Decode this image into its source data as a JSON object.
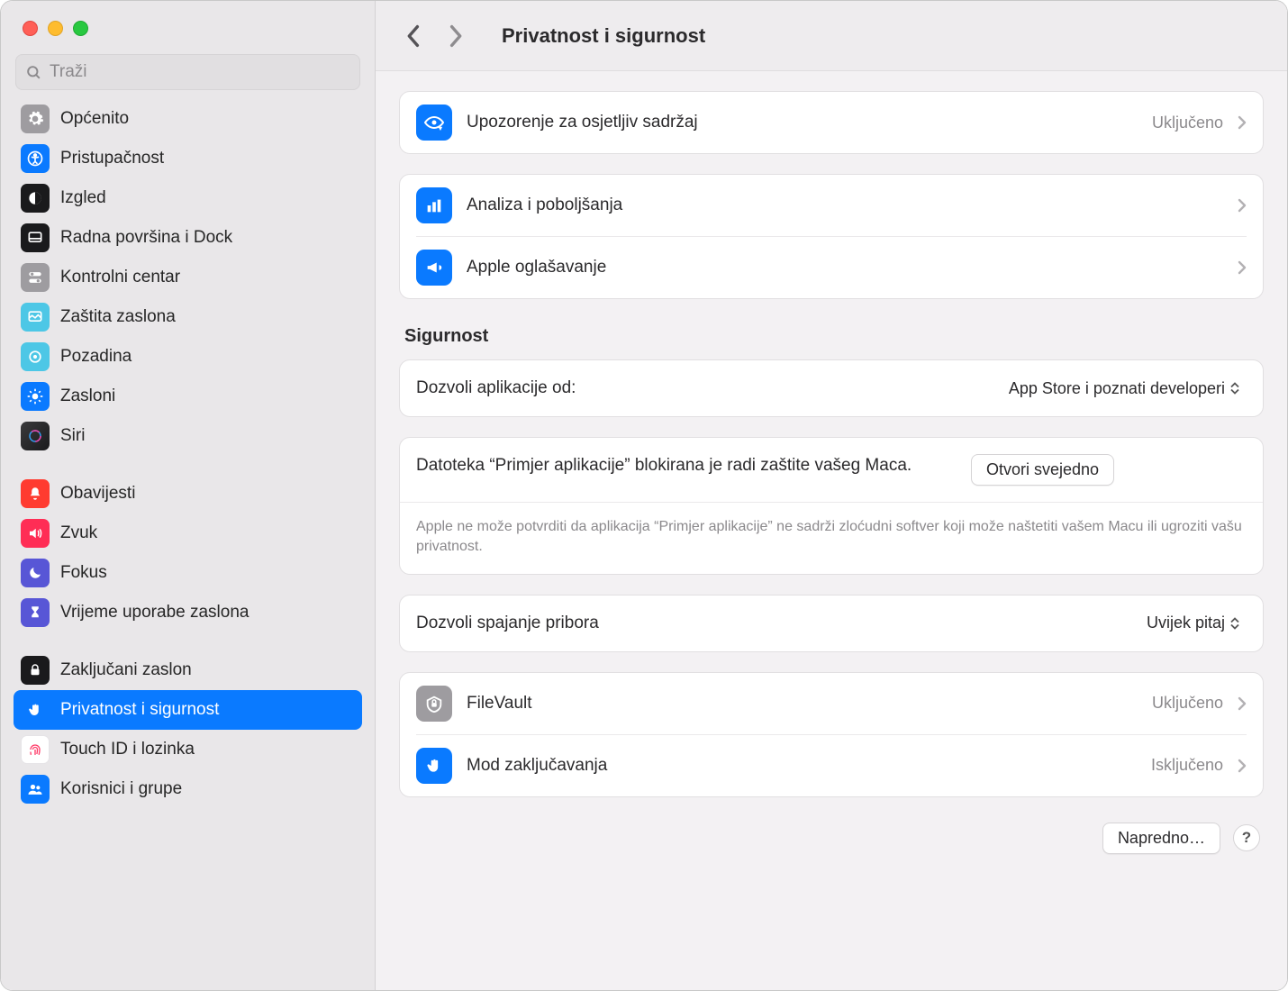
{
  "search_placeholder": "Traži",
  "page_title": "Privatnost i sigurnost",
  "sidebar": [
    {
      "label": "Općenito",
      "icon": "gear",
      "bg": "#9e9ca0"
    },
    {
      "label": "Pristupačnost",
      "icon": "accessibility",
      "bg": "#0a7aff"
    },
    {
      "label": "Izgled",
      "icon": "appearance",
      "bg": "#1a1a1c"
    },
    {
      "label": "Radna površina i Dock",
      "icon": "dock",
      "bg": "#1a1a1c"
    },
    {
      "label": "Kontrolni centar",
      "icon": "control",
      "bg": "#9e9ca0"
    },
    {
      "label": "Zaštita zaslona",
      "icon": "screensaver",
      "bg": "#4dc7e6"
    },
    {
      "label": "Pozadina",
      "icon": "wallpaper",
      "bg": "#4dc7e6"
    },
    {
      "label": "Zasloni",
      "icon": "displays",
      "bg": "#0a7aff"
    },
    {
      "label": "Siri",
      "icon": "siri",
      "bg": "#2b2a2c"
    }
  ],
  "sidebar2": [
    {
      "label": "Obavijesti",
      "icon": "bell",
      "bg": "#ff3b30"
    },
    {
      "label": "Zvuk",
      "icon": "sound",
      "bg": "#ff2d55"
    },
    {
      "label": "Fokus",
      "icon": "moon",
      "bg": "#5856d6"
    },
    {
      "label": "Vrijeme uporabe zaslona",
      "icon": "hourglass",
      "bg": "#5856d6"
    }
  ],
  "sidebar3": [
    {
      "label": "Zaključani zaslon",
      "icon": "lock",
      "bg": "#1a1a1c"
    },
    {
      "label": "Privatnost i sigurnost",
      "icon": "hand",
      "bg": "#0a7aff",
      "selected": true
    },
    {
      "label": "Touch ID i lozinka",
      "icon": "touchid",
      "bg": "#ffffff"
    },
    {
      "label": "Korisnici i grupe",
      "icon": "users",
      "bg": "#0a7aff"
    }
  ],
  "top_rows": {
    "sensitive": {
      "label": "Upozorenje za osjetljiv sadržaj",
      "status": "Uključeno"
    },
    "analytics": {
      "label": "Analiza i poboljšanja"
    },
    "advertising": {
      "label": "Apple oglašavanje"
    }
  },
  "security_header": "Sigurnost",
  "allow_apps": {
    "label": "Dozvoli aplikacije od:",
    "value": "App Store i poznati developeri"
  },
  "blocked": {
    "message": "Datoteka “Primjer aplikacije” blokirana je radi zaštite vašeg Maca.",
    "button": "Otvori svejedno",
    "desc": "Apple ne može potvrditi da aplikacija “Primjer aplikacije” ne sadrži zloćudni softver koji može naštetiti vašem Macu ili ugroziti vašu privatnost."
  },
  "accessories": {
    "label": "Dozvoli spajanje pribora",
    "value": "Uvijek pitaj"
  },
  "filevault": {
    "label": "FileVault",
    "status": "Uključeno"
  },
  "lockdown": {
    "label": "Mod zaključavanja",
    "status": "Isključeno"
  },
  "advanced_button": "Napredno…",
  "help_label": "?"
}
